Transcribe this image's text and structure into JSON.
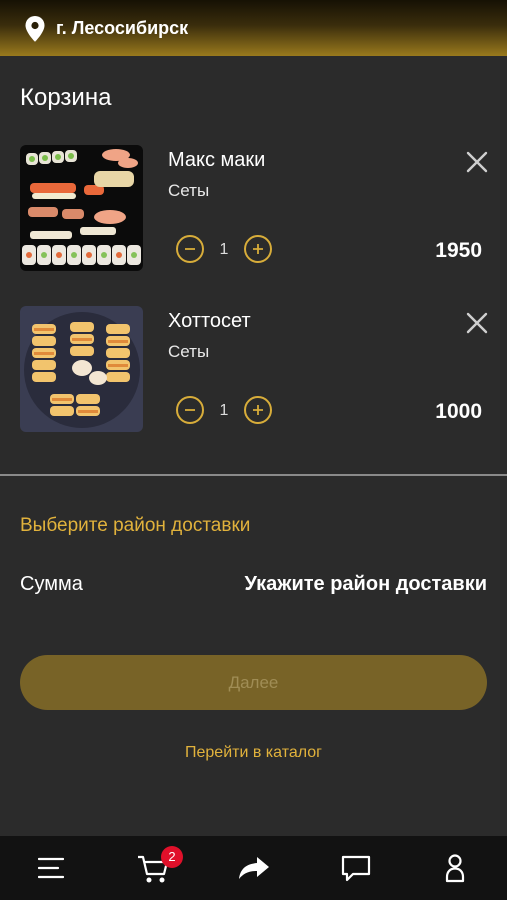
{
  "header": {
    "city": "г. Лесосибирск",
    "location_icon": "map-pin-icon"
  },
  "page": {
    "title": "Корзина"
  },
  "cart": {
    "items": [
      {
        "name": "Макс маки",
        "category": "Сеты",
        "quantity": "1",
        "price": "1950"
      },
      {
        "name": "Хоттосет",
        "category": "Сеты",
        "quantity": "1",
        "price": "1000"
      }
    ]
  },
  "delivery": {
    "choose_district": "Выберите район доставки",
    "sum_label": "Сумма",
    "sum_value": "Укажите район доставки"
  },
  "actions": {
    "next_label": "Далее",
    "catalog_link": "Перейти в каталог"
  },
  "tabbar": {
    "items": [
      "menu-icon",
      "cart-icon",
      "share-icon",
      "chat-icon",
      "profile-icon"
    ],
    "cart_badge": "2"
  },
  "colors": {
    "accent": "#e1b23c",
    "button": "#786327",
    "background": "#2b2b2b",
    "badge": "#e0102a"
  }
}
